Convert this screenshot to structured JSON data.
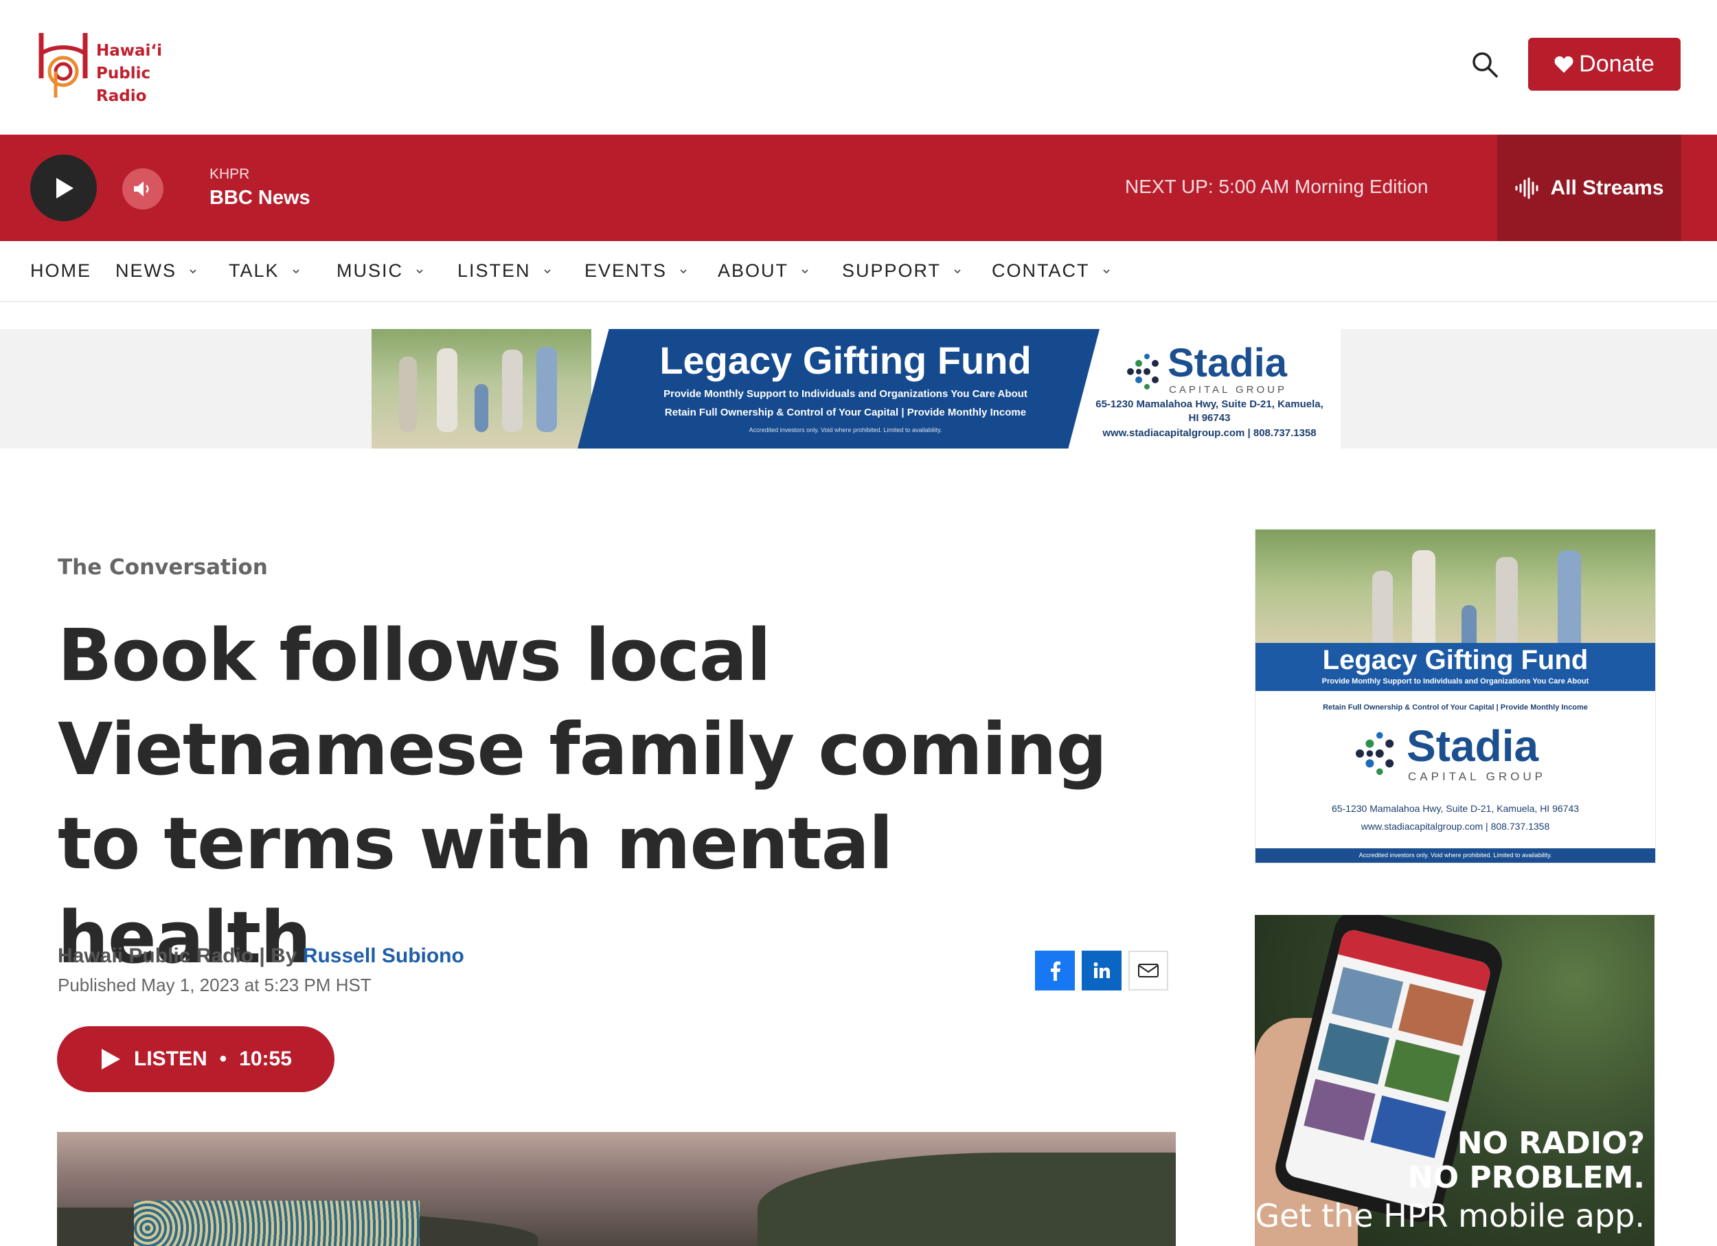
{
  "header": {
    "logo_line1": "Hawai‘i",
    "logo_line2": "Public Radio",
    "donate_label": "Donate",
    "search_icon": "search-icon"
  },
  "player": {
    "station": "KHPR",
    "program": "BBC News",
    "next_up_label": "NEXT UP:",
    "next_up_time": "5:00 AM",
    "next_up_program": "Morning Edition",
    "all_streams_label": "All Streams"
  },
  "nav": {
    "items": [
      {
        "label": "HOME"
      },
      {
        "label": "NEWS"
      },
      {
        "label": "TALK"
      },
      {
        "label": "MUSIC"
      },
      {
        "label": "LISTEN"
      },
      {
        "label": "EVENTS"
      },
      {
        "label": "ABOUT"
      },
      {
        "label": "SUPPORT"
      },
      {
        "label": "CONTACT"
      }
    ]
  },
  "banner_ad": {
    "title": "Legacy Gifting Fund",
    "line1": "Provide Monthly Support to Individuals and Organizations You Care About",
    "line2": "Retain Full Ownership & Control of Your Capital | Provide Monthly Income",
    "fine_print": "Accredited investors only. Void where prohibited. Limited to availability.",
    "brand": "Stadia",
    "brand_sub": "CAPITAL GROUP",
    "address_line1": "65-1230 Mamalahoa Hwy, Suite D-21, Kamuela,",
    "address_line2": "HI 96743",
    "contact": "www.stadiacapitalgroup.com  |  808.737.1358"
  },
  "article": {
    "kicker": "The Conversation",
    "headline": "Book follows local Vietnamese family coming to terms with mental health",
    "byline_source": "Hawaii Public Radio | By ",
    "byline_author": "Russell Subiono",
    "published": "Published May 1, 2023 at 5:23 PM HST",
    "listen_label": "LISTEN",
    "listen_sep": "•",
    "listen_duration": "10:55"
  },
  "side_ad1": {
    "title": "Legacy Gifting Fund",
    "line1": "Provide Monthly Support to Individuals and Organizations You Care About",
    "line2": "Retain Full Ownership & Control of Your Capital | Provide Monthly Income",
    "brand": "Stadia",
    "brand_sub": "CAPITAL GROUP",
    "address": "65-1230 Mamalahoa Hwy, Suite D-21, Kamuela, HI 96743",
    "contact": "www.stadiacapitalgroup.com  |  808.737.1358",
    "fine_print": "Accredited investors only. Void where prohibited. Limited to availability."
  },
  "side_ad2": {
    "line1": "NO RADIO?",
    "line2": "NO PROBLEM.",
    "line3": "Get the HPR mobile app."
  },
  "colors": {
    "brand_red": "#b81d2c",
    "link_blue": "#1f5ea8",
    "facebook": "#1877f2",
    "linkedin": "#0a66c2"
  }
}
